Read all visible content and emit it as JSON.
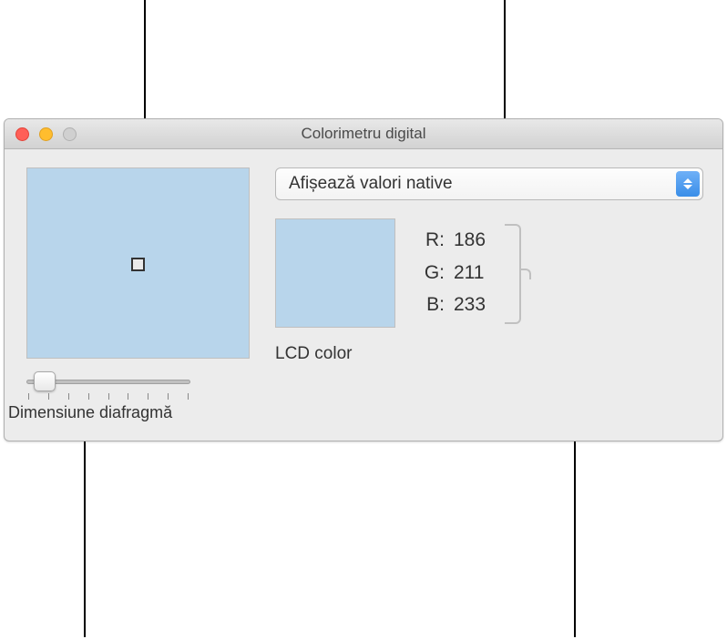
{
  "window": {
    "title": "Colorimetru digital"
  },
  "popup": {
    "selected": "Afișează valori native"
  },
  "color": {
    "r_label": "R:",
    "r_value": "186",
    "g_label": "G:",
    "g_value": "211",
    "b_label": "B:",
    "b_value": "233",
    "swatch_hex": "#b8d5eb"
  },
  "profile": "LCD color",
  "slider": {
    "label": "Dimensiune diafragmă"
  }
}
